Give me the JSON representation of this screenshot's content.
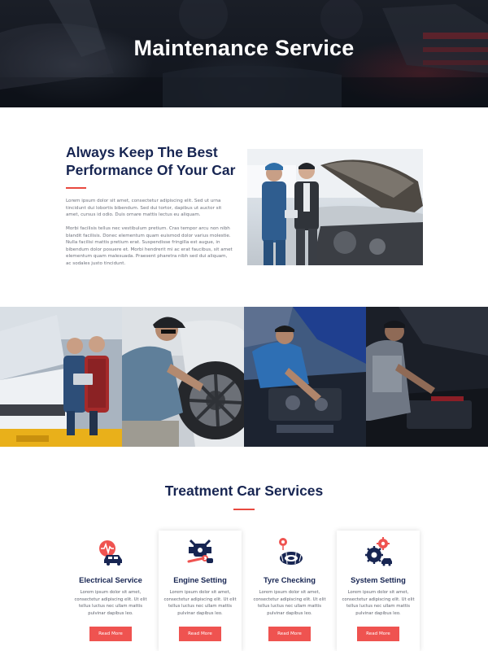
{
  "colors": {
    "navy": "#172552",
    "accent_red": "#e8493f",
    "button_red": "#ef5350",
    "hero_dark": "#141821"
  },
  "hero": {
    "title": "Maintenance Service"
  },
  "about": {
    "heading_line1": "Always Keep The Best",
    "heading_line2": "Performance Of Your Car",
    "paragraph1": "Lorem ipsum dolor sit amet, consectetur adipiscing elit. Sed ut urna tincidunt dui lobortis bibendum. Sed dui tortor, dapibus ut auctor sit amet, cursus id odio. Duis ornare mattis lectus eu aliquam.",
    "paragraph2": "Morbi facilisis tellus nec vestibulum pretium. Cras tempor arcu non nibh blandit facilisis. Donec elementum quam euismod dolor varius molestie. Nulla facilisi mattis pretium erat. Suspendisse fringilla est augue, in bibendum dolor posuere et. Morbi hendrerit mi ac erat faucibus, sit amet elementum quam malesuada. Praesent pharetra nibh sed dui aliquam, ac sodales justo tincidunt.",
    "photo": "mechanic-and-client-inspecting-engine-photo"
  },
  "gallery": {
    "photos": [
      "mechanics-with-laptop-at-van-photo",
      "mechanic-changing-wheel-photo",
      "mechanic-working-under-hood-photo",
      "mechanic-checking-engine-at-night-photo"
    ]
  },
  "services": {
    "title": "Treatment Car Services",
    "items": [
      {
        "icon": "electrical-car-icon",
        "title": "Electrical Service",
        "text": "Lorem ipsum dolor sit amet, consectetur adipiscing elit. Ut elit tellus luctus nec ullam mattis pulvinar dapibus leo.",
        "button": "Read More"
      },
      {
        "icon": "engine-wrench-icon",
        "title": "Engine Setting",
        "text": "Lorem ipsum dolor sit amet, consectetur adipiscing elit. Ut elit tellus luctus nec ullam mattis pulvinar dapibus leo.",
        "button": "Read More"
      },
      {
        "icon": "tyre-pressure-icon",
        "title": "Tyre Checking",
        "text": "Lorem ipsum dolor sit amet, consectetur adipiscing elit. Ut elit tellus luctus nec ullam mattis pulvinar dapibus leo.",
        "button": "Read More"
      },
      {
        "icon": "gears-car-icon",
        "title": "System Setting",
        "text": "Lorem ipsum dolor sit amet, consectetur adipiscing elit. Ut elit tellus luctus nec ullam mattis pulvinar dapibus leo.",
        "button": "Read More"
      }
    ]
  }
}
